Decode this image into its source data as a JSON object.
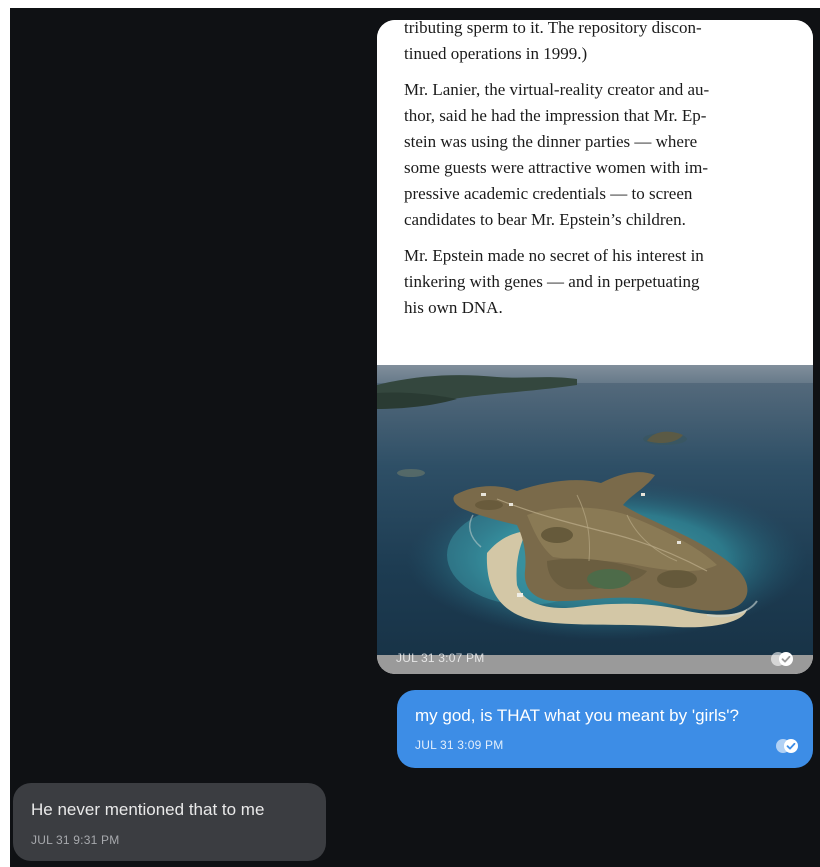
{
  "messages": {
    "image_message": {
      "article_paragraphs": [
        "tributing sperm to it. The repository discon-\ntinued operations in 1999.)",
        "Mr. Lanier, the virtual-reality creator and au-\nthor, said he had the impression that Mr. Ep-\nstein was using the dinner parties — where\nsome guests were attractive women with im-\npressive academic credentials — to screen\ncandidates to bear Mr. Epstein’s children.",
        "Mr. Epstein made no secret of his interest in\ntinkering with genes — and in perpetuating\nhis own DNA."
      ],
      "time": "JUL 31 3:07 PM",
      "status_icon": "read-receipt-icon"
    },
    "outgoing_text": {
      "text": "my god, is THAT what you meant by 'girls'?",
      "time": "JUL 31 3:09 PM",
      "status_icon": "read-receipt-icon"
    },
    "incoming_text": {
      "text": "He never mentioned that to me",
      "time": "JUL 31 9:31 PM"
    }
  },
  "colors": {
    "background": "#0f1114",
    "outgoing_bubble": "#3d8de6",
    "incoming_bubble": "#3b3d41"
  }
}
